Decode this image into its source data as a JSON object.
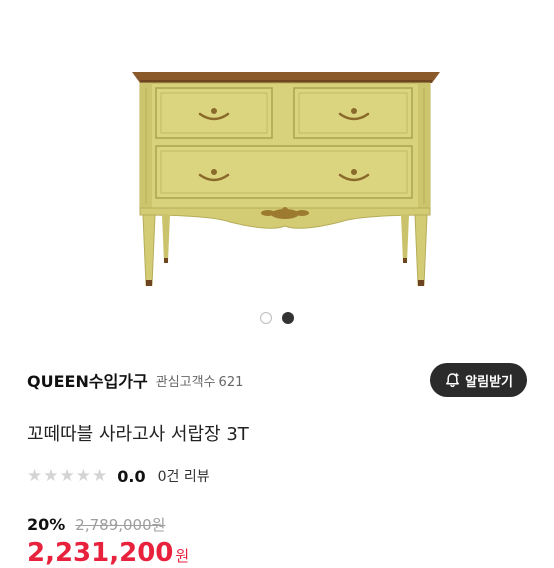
{
  "carousel": {
    "total": 2,
    "active_index": 1
  },
  "seller": {
    "name": "QUEEN수입가구",
    "watchers_label": "관심고객수",
    "watchers_count": "621"
  },
  "notify_button": {
    "label": "알림받기",
    "icon": "bell-plus-icon"
  },
  "product": {
    "title": "꼬떼따블 사라고사 서랍장 3T"
  },
  "rating": {
    "stars_filled": 0,
    "stars_total": 5,
    "value": "0.0",
    "review_count": "0건",
    "review_label": "리뷰"
  },
  "price": {
    "discount": "20%",
    "original": "2,789,000원",
    "final": "2,231,200",
    "final_unit": "원"
  },
  "colors": {
    "accent_red": "#e8223d",
    "button_dark": "#2b2b2b",
    "star_empty": "#d4d4d4",
    "chest_body": "#d9d27c",
    "chest_top": "#8a5a2b",
    "handle_brass": "#8a6a2a"
  }
}
